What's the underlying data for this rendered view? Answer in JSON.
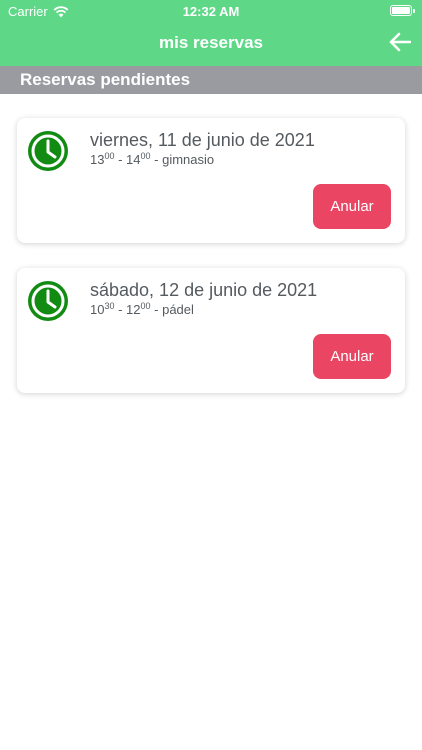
{
  "status_bar": {
    "carrier": "Carrier",
    "time": "12:32 AM"
  },
  "nav": {
    "title": "mis reservas",
    "back_icon": "arrow-left-icon"
  },
  "section": {
    "title": "Reservas pendientes"
  },
  "reservations": [
    {
      "date": "viernes, 11 de junio de 2021",
      "start_hour": "13",
      "start_min": "00",
      "end_hour": "14",
      "end_min": "00",
      "activity": "gimnasio",
      "button_label": "Anular"
    },
    {
      "date": "sábado, 12 de junio de 2021",
      "start_hour": "10",
      "start_min": "30",
      "end_hour": "12",
      "end_min": "00",
      "activity": "pádel",
      "button_label": "Anular"
    }
  ],
  "colors": {
    "header": "#5ed887",
    "section": "#9a9ba1",
    "clock": "#118b12",
    "cancel": "#ea4562",
    "text": "#555a5e"
  }
}
